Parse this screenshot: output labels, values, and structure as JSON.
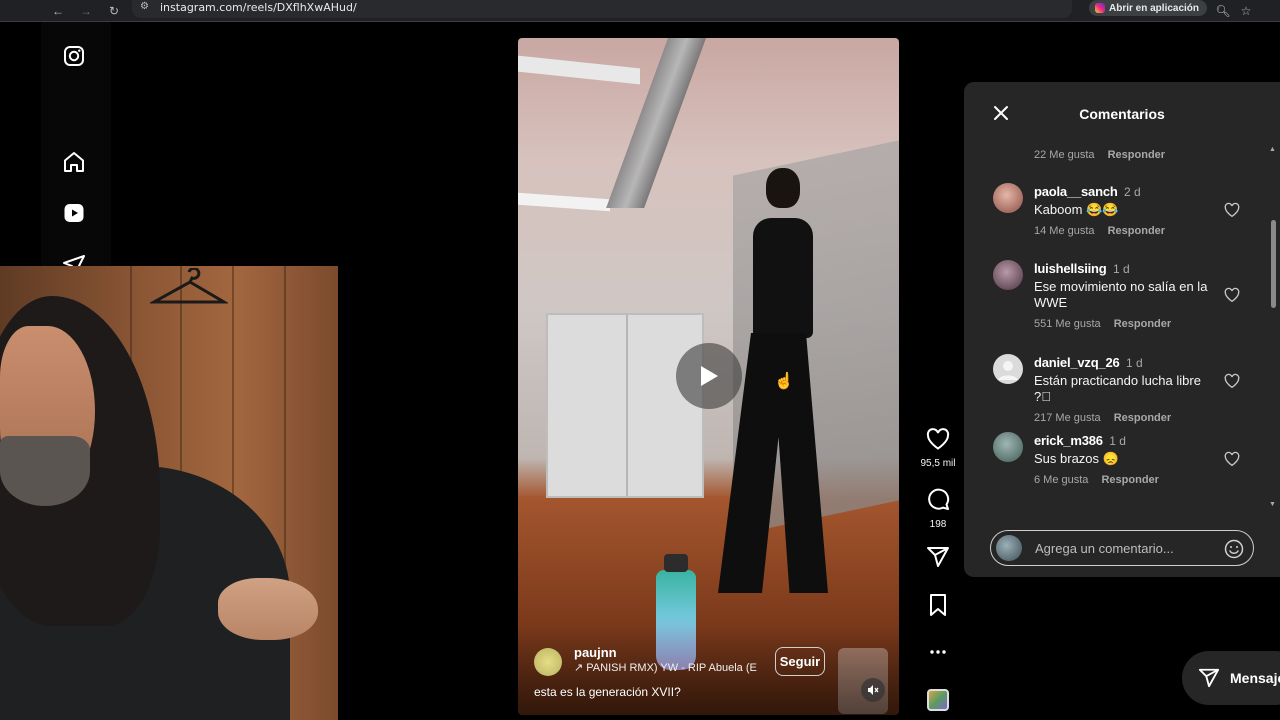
{
  "browser": {
    "url": "instagram.com/reels/DXflhXwAHud/",
    "open_app_label": "Abrir en aplicación"
  },
  "video": {
    "username": "paujnn",
    "audio": "↗ PANISH RMX) YW - RIP Abuela (E",
    "follow_label": "Seguir",
    "caption": "esta es la generación XVII?"
  },
  "actions": {
    "likes": "95,5 mil",
    "comments": "198"
  },
  "comments_panel": {
    "title": "Comentarios",
    "top_meta": {
      "likes": "22 Me gusta",
      "reply": "Responder"
    },
    "comments": [
      {
        "user": "paola__sanch",
        "time": "2 d",
        "text": "Kaboom 😂😂",
        "likes": "14 Me gusta",
        "reply": "Responder",
        "avatar_color": "#c98a7a"
      },
      {
        "user": "luishellsiing",
        "time": "1 d",
        "text": "Ese movimiento no salía en la WWE",
        "likes": "551 Me gusta",
        "reply": "Responder",
        "avatar_color": "#7a5c6b"
      },
      {
        "user": "daniel_vzq_26",
        "time": "1 d",
        "text": "Están practicando lucha libre ?⃞",
        "likes": "217 Me gusta",
        "reply": "Responder",
        "avatar_color": "#c7c7c7"
      },
      {
        "user": "erick_m386",
        "time": "1 d",
        "text": "Sus brazos 😞",
        "likes": "6 Me gusta",
        "reply": "Responder",
        "avatar_color": "#6f8a86"
      }
    ],
    "input_placeholder": "Agrega un comentario..."
  },
  "messages": {
    "label": "Mensajes"
  },
  "colors": {
    "panel_bg": "#262626",
    "page_bg": "#000000",
    "text_secondary": "#a8a8a8"
  }
}
